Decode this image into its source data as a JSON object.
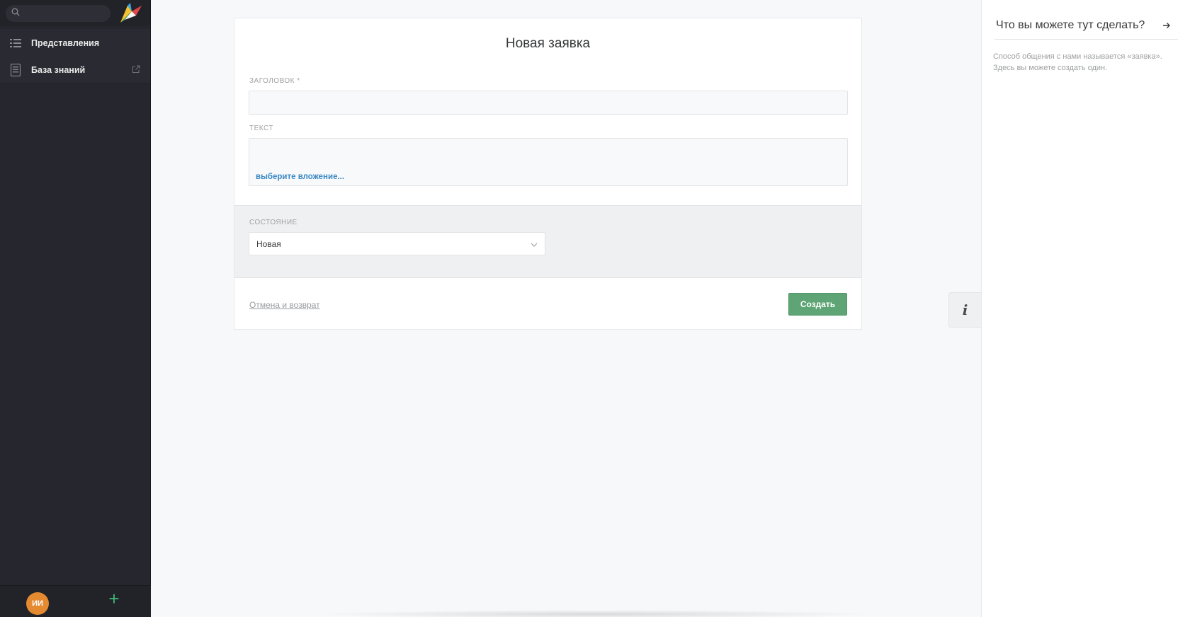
{
  "sidebar": {
    "search": {
      "placeholder": ""
    },
    "items": [
      {
        "label": "Представления",
        "icon": "list-icon"
      },
      {
        "label": "База знаний",
        "icon": "book-icon"
      }
    ],
    "avatar_initials": "ИИ",
    "add_label": "+"
  },
  "form": {
    "title": "Новая заявка",
    "title_field_label": "ЗАГОЛОВОК *",
    "text_field_label": "ТЕКСТ",
    "attach_link": "выберите вложение...",
    "state_label": "СОСТОЯНИЕ",
    "state_value": "Новая",
    "cancel_label": "Отмена и возврат",
    "submit_label": "Создать"
  },
  "info_toggle": {
    "icon": "info-icon",
    "label": "i"
  },
  "help_panel": {
    "title": "Что вы можете тут сделать?",
    "close_icon": "arrow-right-icon",
    "text": "Способ общения с нами называется «заявка». Здесь вы можете создать один."
  },
  "colors": {
    "sidebar_bg": "#26272e",
    "accent_green": "#5ea474",
    "link_blue": "#3a88c4",
    "avatar_orange": "#e48a31"
  }
}
